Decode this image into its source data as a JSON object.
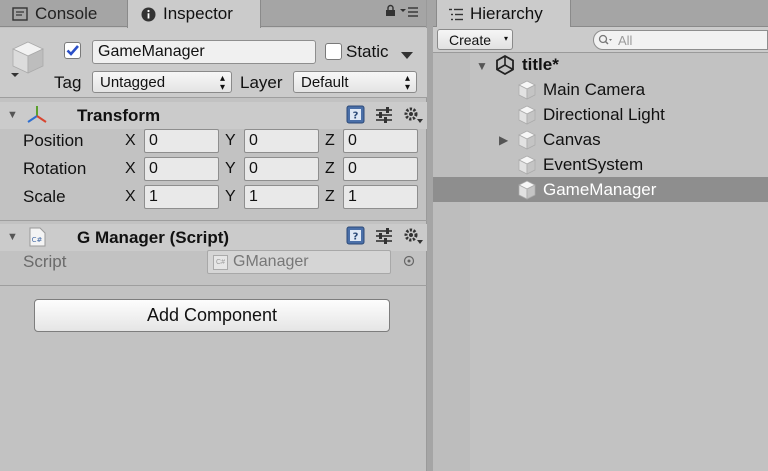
{
  "inspector_panel": {
    "tabs": [
      {
        "label": "Console",
        "icon": "console-icon"
      },
      {
        "label": "Inspector",
        "icon": "info-icon"
      }
    ],
    "object": {
      "name": "GameManager",
      "active": true,
      "static_label": "Static",
      "tag_label": "Tag",
      "tag_value": "Untagged",
      "layer_label": "Layer",
      "layer_value": "Default"
    },
    "transform": {
      "title": "Transform",
      "rows": [
        {
          "label": "Position",
          "x": "0",
          "y": "0",
          "z": "0"
        },
        {
          "label": "Rotation",
          "x": "0",
          "y": "0",
          "z": "0"
        },
        {
          "label": "Scale",
          "x": "1",
          "y": "1",
          "z": "1"
        }
      ],
      "axes": {
        "x": "X",
        "y": "Y",
        "z": "Z"
      }
    },
    "script_component": {
      "title": "G Manager (Script)",
      "script_label": "Script",
      "script_value": "GManager",
      "cs_badge": "C#"
    },
    "add_component_label": "Add Component"
  },
  "hierarchy_panel": {
    "tab_label": "Hierarchy",
    "create_label": "Create",
    "search_placeholder": "All",
    "scene": {
      "name": "title*",
      "expanded": true
    },
    "items": [
      {
        "label": "Main Camera",
        "has_children": false,
        "selected": false
      },
      {
        "label": "Directional Light",
        "has_children": false,
        "selected": false
      },
      {
        "label": "Canvas",
        "has_children": true,
        "selected": false
      },
      {
        "label": "EventSystem",
        "has_children": false,
        "selected": false
      },
      {
        "label": "GameManager",
        "has_children": false,
        "selected": true
      }
    ]
  },
  "colors": {
    "accent_checkbox": "#2b4fc7",
    "selection_row": "#8e8e8e",
    "panel_bg": "#c2c2c2"
  }
}
